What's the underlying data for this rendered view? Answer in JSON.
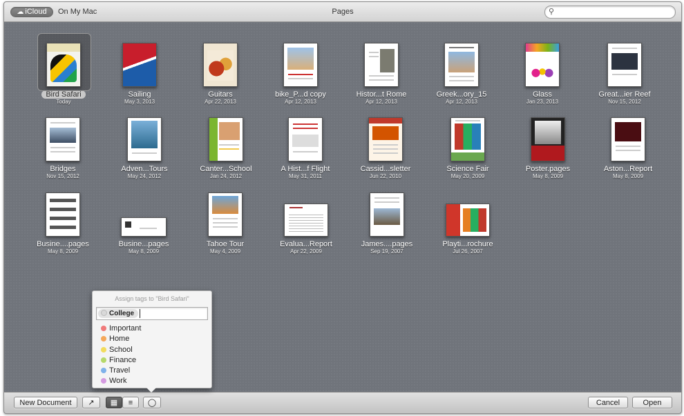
{
  "titlebar": {
    "title": "Pages",
    "source_icloud": "iCloud",
    "source_mac": "On My Mac",
    "search_placeholder": "",
    "search_icon": "magnifier-icon",
    "cloud_icon": "cloud-icon"
  },
  "documents": [
    {
      "name": "Bird Safari",
      "date": "Today",
      "selected": true
    },
    {
      "name": "Sailing",
      "date": "May 3, 2013"
    },
    {
      "name": "Guitars",
      "date": "Apr 22, 2013"
    },
    {
      "name": "bike_P...d copy",
      "date": "Apr 12, 2013"
    },
    {
      "name": "Histor...t Rome",
      "date": "Apr 12, 2013"
    },
    {
      "name": "Greek...ory_15",
      "date": "Apr 12, 2013"
    },
    {
      "name": "Glass",
      "date": "Jan 23, 2013"
    },
    {
      "name": "Great...ier Reef",
      "date": "Nov 15, 2012"
    },
    {
      "name": "Bridges",
      "date": "Nov 15, 2012"
    },
    {
      "name": "Adven...Tours",
      "date": "May 24, 2012"
    },
    {
      "name": "Canter...School",
      "date": "Jan 24, 2012"
    },
    {
      "name": "A Hist...f Flight",
      "date": "May 31, 2011"
    },
    {
      "name": "Cassid...sletter",
      "date": "Jun 22, 2010"
    },
    {
      "name": "Science Fair",
      "date": "May 20, 2009"
    },
    {
      "name": "Poster.pages",
      "date": "May 8, 2009"
    },
    {
      "name": "Aston...Report",
      "date": "May 8, 2009"
    },
    {
      "name": "Busine....pages",
      "date": "May 8, 2009"
    },
    {
      "name": "Busine...pages",
      "date": "May 8, 2009"
    },
    {
      "name": "Tahoe Tour",
      "date": "May 4, 2009"
    },
    {
      "name": "Evalua...Report",
      "date": "Apr 22, 2009"
    },
    {
      "name": "James....pages",
      "date": "Sep 19, 2007"
    },
    {
      "name": "Playti...rochure",
      "date": "Jul 26, 2007"
    }
  ],
  "tag_popover": {
    "title": "Assign tags to \"Bird Safari\"",
    "current_tag": "College",
    "tags": [
      {
        "label": "Important",
        "color": "#f07a7a"
      },
      {
        "label": "Home",
        "color": "#f5a85a"
      },
      {
        "label": "School",
        "color": "#f2dc5d"
      },
      {
        "label": "Finance",
        "color": "#b5d86a"
      },
      {
        "label": "Travel",
        "color": "#7fb2ea"
      },
      {
        "label": "Work",
        "color": "#d49ae0"
      }
    ]
  },
  "bottombar": {
    "new_document": "New Document",
    "cancel": "Cancel",
    "open": "Open",
    "share_icon": "share-icon",
    "grid_icon": "grid-view-icon",
    "list_icon": "list-view-icon",
    "tag_icon": "tag-icon"
  }
}
